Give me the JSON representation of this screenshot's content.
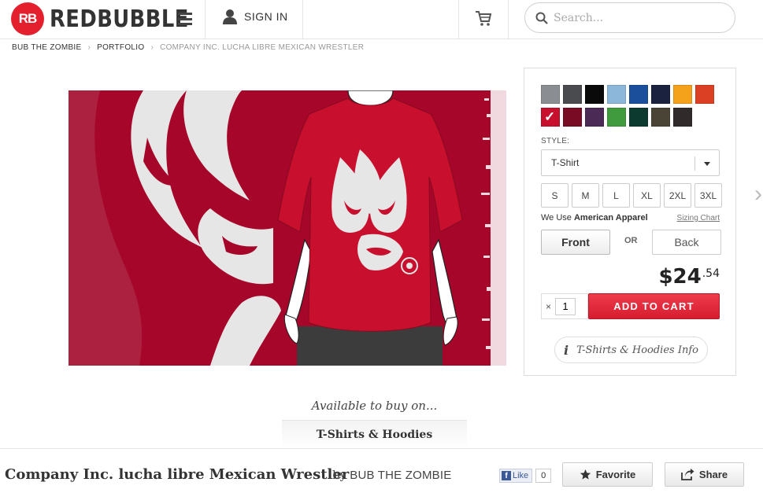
{
  "header": {
    "logo_mark": "RB",
    "logo_text": "REDBUBBLE",
    "signin_label": "SIGN IN",
    "search_placeholder": "Search..."
  },
  "breadcrumb": {
    "items": [
      "BUB THE ZOMBIE",
      "PORTFOLIO"
    ],
    "current": "COMPANY INC. LUCHA LIBRE MEXICAN WRESTLER"
  },
  "panel": {
    "colors": [
      "#8a8d91",
      "#4a4b4f",
      "#0a0a0a",
      "#8cb6da",
      "#1b4f9c",
      "#1b2240",
      "#f4a21b",
      "#dc4024",
      "#c8102e",
      "#7a0b25",
      "#4b2a55",
      "#3f9b3d",
      "#0d3a2e",
      "#4a4436",
      "#302a2a"
    ],
    "selected_color": "#c8102e",
    "style_label": "STYLE:",
    "style_value": "T-Shirt",
    "sizes": [
      "S",
      "M",
      "L",
      "XL",
      "2XL",
      "3XL"
    ],
    "apparel_prefix": "We Use",
    "apparel_brand": "American Apparel",
    "sizing_chart_label": "Sizing Chart",
    "front_label": "Front",
    "or_label": "OR",
    "back_label": "Back",
    "price_dollars": "$24",
    "price_cents": ".54",
    "qty_x": "×",
    "quantity": "1",
    "add_to_cart_label": "ADD TO CART",
    "info_label": "T-Shirts & Hoodies Info"
  },
  "available": {
    "heading": "Available to buy on...",
    "tab_label": "T-Shirts & Hoodies"
  },
  "footer": {
    "work_title": "Company Inc. lucha libre Mexican Wrestler",
    "by_label": "by",
    "artist": "BUB THE ZOMBIE",
    "fb_label": "Like",
    "fb_count": "0",
    "favorite_label": "Favorite",
    "share_label": "Share"
  }
}
